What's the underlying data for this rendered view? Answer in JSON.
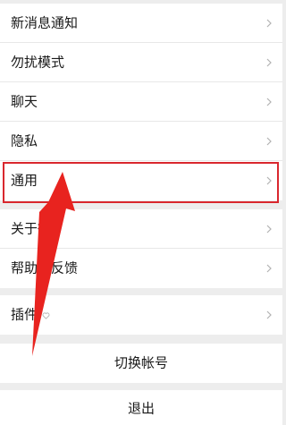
{
  "settings_group_1": {
    "items": [
      {
        "label": "新消息通知"
      },
      {
        "label": "勿扰模式"
      },
      {
        "label": "聊天"
      },
      {
        "label": "隐私"
      },
      {
        "label": "通用"
      }
    ]
  },
  "settings_group_2": {
    "items": [
      {
        "label": "关于微"
      },
      {
        "label": "帮助与反馈"
      }
    ]
  },
  "settings_group_3": {
    "items": [
      {
        "label": "插件"
      }
    ]
  },
  "account": {
    "switch_label": "切换帐号",
    "logout_label": "退出"
  },
  "colors": {
    "highlight": "#d9272e",
    "arrow": "#e8231f",
    "background": "#ededed",
    "chevron": "#b2b2b2"
  },
  "icons": {
    "chevron": "chevron-right-icon",
    "plugin_badge": "heart-outline-icon"
  }
}
